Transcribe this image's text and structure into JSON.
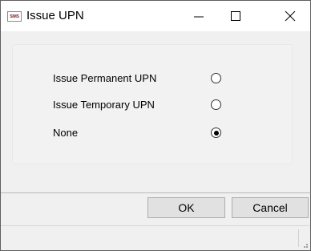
{
  "window": {
    "title": "Issue UPN",
    "app_icon_text": "SIMS",
    "app_icon": "sims-app-icon",
    "controls": [
      "minimize-icon",
      "maximize-icon",
      "close-icon"
    ]
  },
  "options": [
    {
      "label": "Issue Permanent UPN",
      "selected": false
    },
    {
      "label": "Issue Temporary UPN",
      "selected": false
    },
    {
      "label": "None",
      "selected": true
    }
  ],
  "buttons": {
    "ok_label": "OK",
    "cancel_label": "Cancel"
  },
  "colors": {
    "window_background": "#f0f0f0",
    "titlebar_background": "#ffffff",
    "button_background": "#e1e1e1"
  }
}
